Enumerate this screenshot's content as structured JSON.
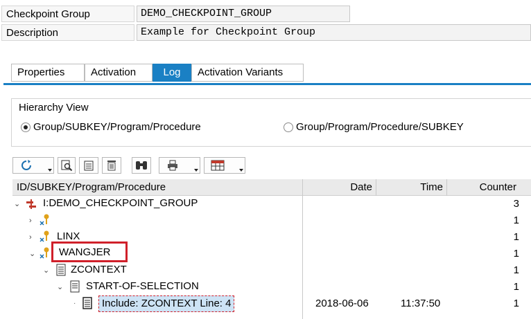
{
  "header": {
    "checkpoint_group_label": "Checkpoint Group",
    "checkpoint_group_value": "DEMO_CHECKPOINT_GROUP",
    "description_label": "Description",
    "description_value": "Example for Checkpoint Group"
  },
  "tabs": [
    {
      "label": "Properties",
      "active": false
    },
    {
      "label": "Activation",
      "active": false
    },
    {
      "label": "Log",
      "active": true
    },
    {
      "label": "Activation Variants",
      "active": false
    }
  ],
  "hierarchy": {
    "title": "Hierarchy View",
    "options": [
      {
        "label": "Group/SUBKEY/Program/Procedure",
        "selected": true
      },
      {
        "label": "Group/Program/Procedure/SUBKEY",
        "selected": false
      }
    ]
  },
  "toolbar": {
    "icons": [
      "refresh-icon",
      "find-icon",
      "expand-icon",
      "delete-icon",
      "binoculars-icon",
      "print-icon",
      "layout-icon"
    ]
  },
  "table": {
    "columns": [
      "ID/SUBKEY/Program/Procedure",
      "Date",
      "Time",
      "Counter"
    ],
    "rows": [
      {
        "label": "I:DEMO_CHECKPOINT_GROUP",
        "date": "",
        "time": "",
        "counter": "3"
      },
      {
        "label": "",
        "date": "",
        "time": "",
        "counter": "1"
      },
      {
        "label": "LINX",
        "date": "",
        "time": "",
        "counter": "1"
      },
      {
        "label": "WANGJER",
        "date": "",
        "time": "",
        "counter": "1"
      },
      {
        "label": "ZCONTEXT",
        "date": "",
        "time": "",
        "counter": "1"
      },
      {
        "label": "START-OF-SELECTION",
        "date": "",
        "time": "",
        "counter": "1"
      },
      {
        "label": "Include: ZCONTEXT  Line: 4",
        "date": "2018-06-06",
        "time": "11:37:50",
        "counter": "1"
      }
    ]
  },
  "colors": {
    "accent": "#1a80c4",
    "highlight_border": "#d0202a",
    "key_icon": "#e0a21a",
    "tree_icon": "#c0392b"
  }
}
